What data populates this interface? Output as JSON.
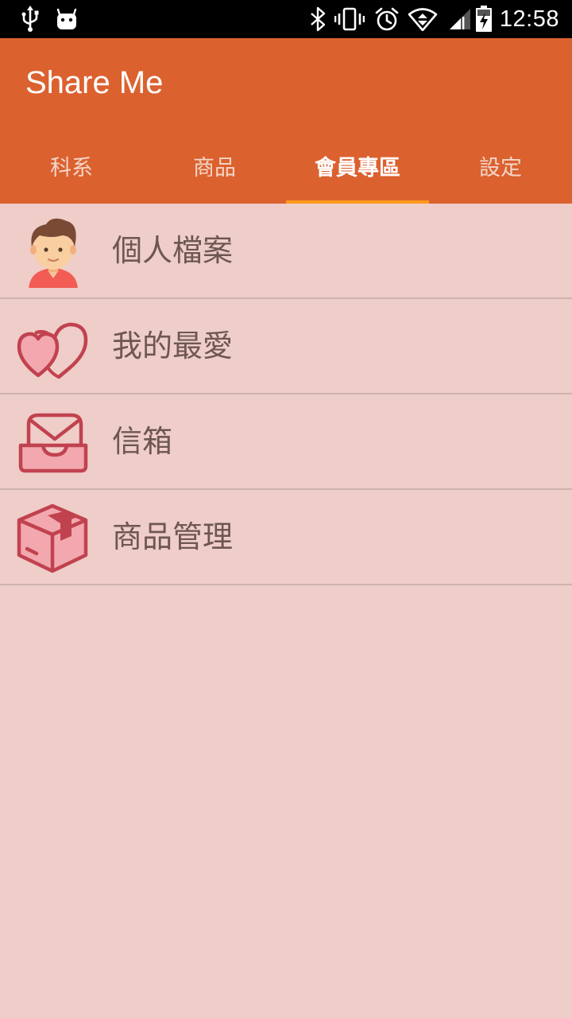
{
  "status_bar": {
    "time": "12:58",
    "left_icons": [
      "usb-icon",
      "android-debug-icon"
    ],
    "right_icons": [
      "bluetooth-icon",
      "vibrate-icon",
      "alarm-icon",
      "wifi-icon",
      "signal-icon",
      "battery-charging-icon"
    ]
  },
  "app_bar": {
    "title": "Share Me",
    "background_color": "#db612f"
  },
  "tabs": [
    {
      "label": "科系",
      "active": false
    },
    {
      "label": "商品",
      "active": false
    },
    {
      "label": "會員專區",
      "active": true
    },
    {
      "label": "設定",
      "active": false
    }
  ],
  "tab_indicator_color": "#ff9a1e",
  "menu": {
    "items": [
      {
        "label": "個人檔案",
        "icon": "user-avatar-icon"
      },
      {
        "label": "我的最愛",
        "icon": "hearts-icon"
      },
      {
        "label": "信箱",
        "icon": "inbox-mail-icon"
      },
      {
        "label": "商品管理",
        "icon": "package-box-icon"
      }
    ]
  },
  "colors": {
    "page_background": "#efcdc8",
    "icon_accent": "#c1424f",
    "list_text": "#6e5753"
  }
}
